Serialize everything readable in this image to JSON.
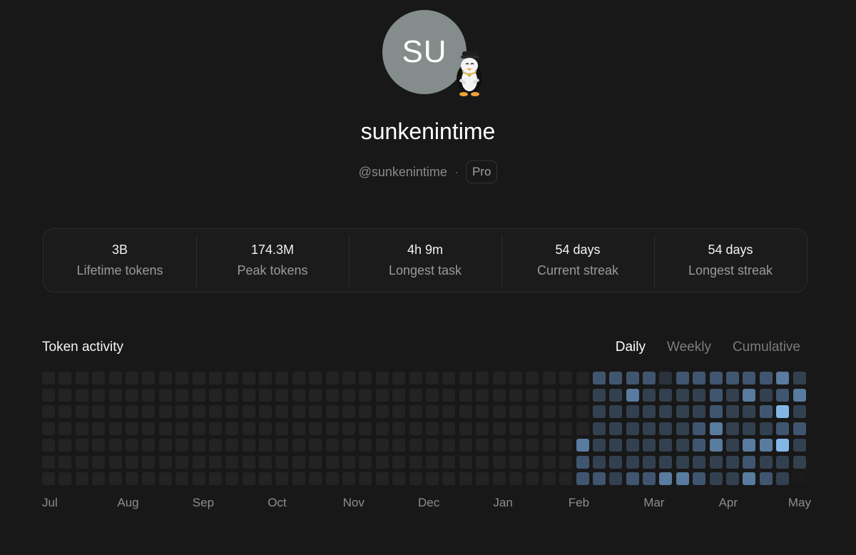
{
  "profile": {
    "avatar_initials": "SU",
    "badge_icon": "penguin-icon",
    "display_name": "sunkenintime",
    "handle": "@sunkenintime",
    "separator": "·",
    "plan": "Pro"
  },
  "stats": [
    {
      "value": "3B",
      "label": "Lifetime tokens"
    },
    {
      "value": "174.3M",
      "label": "Peak tokens"
    },
    {
      "value": "4h 9m",
      "label": "Longest task"
    },
    {
      "value": "54 days",
      "label": "Current streak"
    },
    {
      "value": "54 days",
      "label": "Longest streak"
    }
  ],
  "activity": {
    "title": "Token activity",
    "tabs": [
      {
        "label": "Daily",
        "active": true
      },
      {
        "label": "Weekly",
        "active": false
      },
      {
        "label": "Cumulative",
        "active": false
      }
    ],
    "months": [
      "Jul",
      "Aug",
      "Sep",
      "Oct",
      "Nov",
      "Dec",
      "Jan",
      "Feb",
      "Mar",
      "Apr",
      "May"
    ],
    "level_colors": [
      "#232323",
      "#2b323c",
      "#33404f",
      "#405670",
      "#587b9f",
      "#82b6e6",
      "#1a1a1a"
    ],
    "active_weeks": [
      [
        0,
        0,
        0,
        0,
        4,
        3,
        3
      ],
      [
        3,
        2,
        2,
        2,
        2,
        2,
        3
      ],
      [
        3,
        2,
        2,
        2,
        2,
        2,
        2
      ],
      [
        3,
        4,
        2,
        2,
        2,
        2,
        3
      ],
      [
        3,
        2,
        2,
        2,
        2,
        2,
        3
      ],
      [
        1,
        2,
        2,
        2,
        2,
        2,
        4
      ],
      [
        3,
        2,
        2,
        2,
        2,
        2,
        4
      ],
      [
        3,
        2,
        2,
        3,
        3,
        2,
        3
      ],
      [
        3,
        3,
        3,
        4,
        4,
        2,
        2
      ],
      [
        3,
        2,
        2,
        2,
        2,
        2,
        2
      ],
      [
        3,
        4,
        2,
        2,
        4,
        3,
        4
      ],
      [
        3,
        2,
        3,
        2,
        4,
        2,
        3
      ],
      [
        4,
        3,
        5,
        3,
        5,
        2,
        2
      ],
      [
        2,
        4,
        2,
        3,
        2,
        2,
        6
      ]
    ]
  }
}
